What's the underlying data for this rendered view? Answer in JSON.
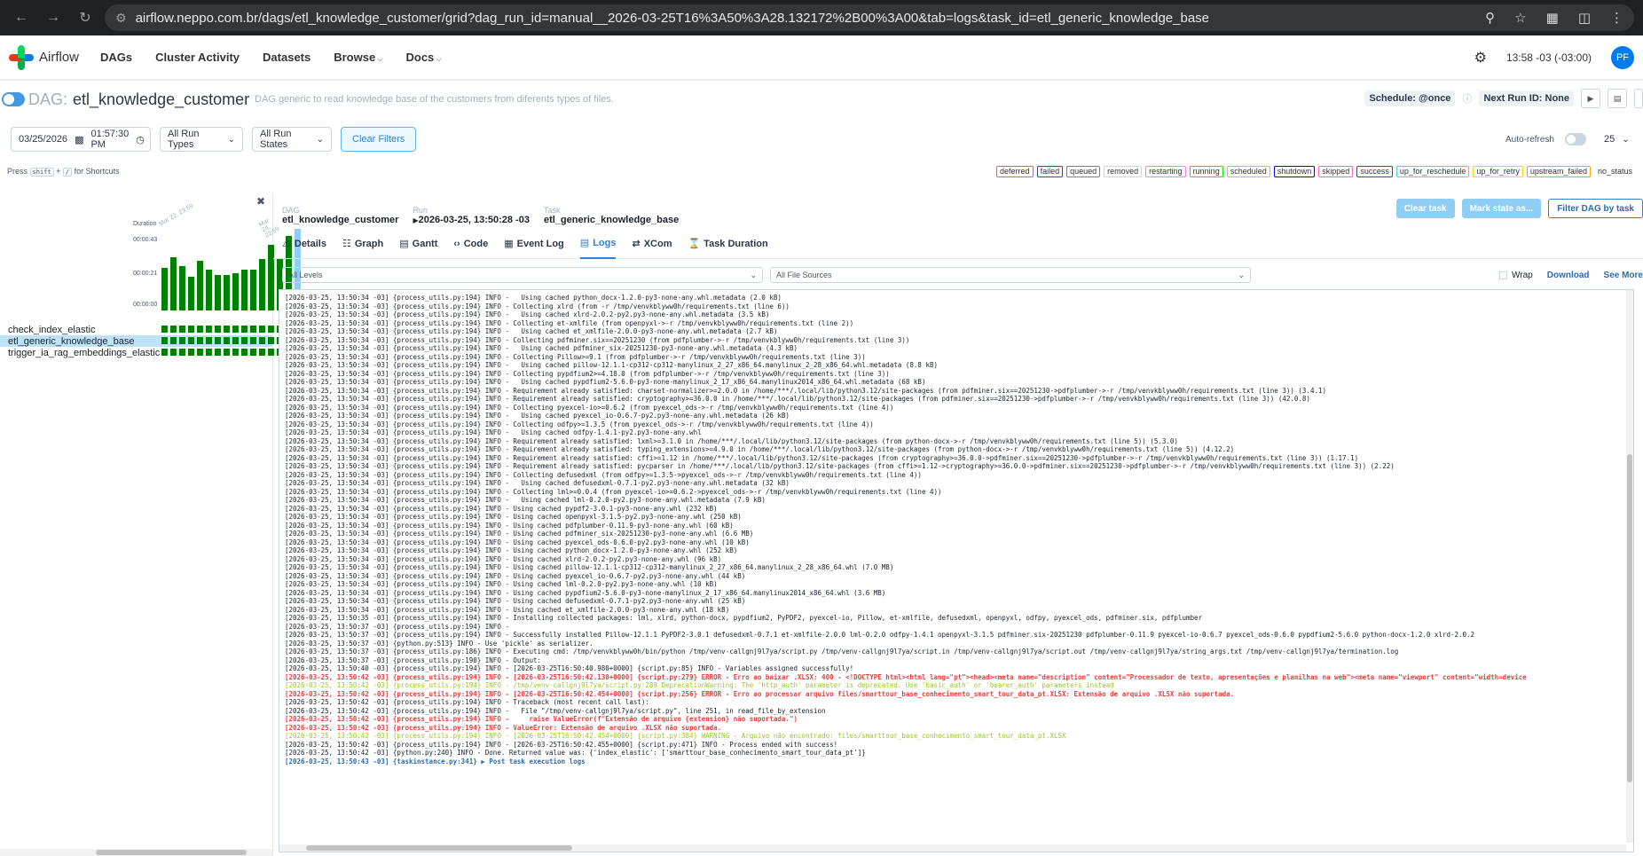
{
  "browser": {
    "url": "airflow.neppo.com.br/dags/etl_knowledge_customer/grid?dag_run_id=manual__2026-03-25T16%3A50%3A28.132172%2B00%3A00&tab=logs&task_id=etl_generic_knowledge_base"
  },
  "nav": {
    "brand": "Airflow",
    "items": [
      "DAGs",
      "Cluster Activity",
      "Datasets",
      "Browse",
      "Docs"
    ],
    "time": "13:58 -03 (-03:00)",
    "avatar": "PF"
  },
  "dag": {
    "prefix": "DAG:",
    "name": "etl_knowledge_customer",
    "description": "DAG generic to read knowledge base of the customers from diferents types of files.",
    "schedule": "Schedule: @once",
    "next_run": "Next Run ID: None"
  },
  "filters": {
    "date": "03/25/2026",
    "time": "01:57:30 PM",
    "run_types": "All Run Types",
    "run_states": "All Run States",
    "clear": "Clear Filters",
    "auto_refresh": "Auto-refresh",
    "page_size": "25"
  },
  "shortcut": {
    "press": "Press",
    "k1": "shift",
    "plus": "+",
    "k2": "/",
    "suffix": "for Shortcuts"
  },
  "legend": [
    {
      "label": "deferred",
      "color": "#9370db"
    },
    {
      "label": "failed",
      "color": "#ff0000"
    },
    {
      "label": "queued",
      "color": "#808080"
    },
    {
      "label": "removed",
      "color": "#d3d3d3"
    },
    {
      "label": "restarting",
      "color": "#ee82ee"
    },
    {
      "label": "running",
      "color": "#00ff00"
    },
    {
      "label": "scheduled",
      "color": "#d2b48c"
    },
    {
      "label": "shutdown",
      "color": "#0000ff"
    },
    {
      "label": "skipped",
      "color": "#ff69b4"
    },
    {
      "label": "success",
      "color": "#008000"
    },
    {
      "label": "up_for_reschedule",
      "color": "#40e0d0"
    },
    {
      "label": "up_for_retry",
      "color": "#ffd700"
    },
    {
      "label": "upstream_failed",
      "color": "#ffa500"
    },
    {
      "label": "no_status",
      "color": "#ffffff"
    }
  ],
  "grid": {
    "duration_label": "Duration",
    "ticks": [
      "00:00:43",
      "00:00:21",
      "00:00:00"
    ],
    "dates": [
      "Mar 22, 23:59",
      "Mar 24, 22:59"
    ],
    "tasks": [
      "check_index_elastic",
      "etl_generic_knowledge_base",
      "trigger_ia_rag_embeddings_elastic"
    ]
  },
  "task_detail": {
    "dag_label": "DAG",
    "dag_value": "etl_knowledge_customer",
    "run_label": "Run",
    "run_value": "2026-03-25, 13:50:28 -03",
    "task_label": "Task",
    "task_value": "etl_generic_knowledge_base",
    "clear_task": "Clear task",
    "mark_state": "Mark state as...",
    "filter_dag": "Filter DAG by task"
  },
  "tabs": [
    "Details",
    "Graph",
    "Gantt",
    "Code",
    "Event Log",
    "Logs",
    "XCom",
    "Task Duration"
  ],
  "log_controls": {
    "levels": "All Levels",
    "sources": "All File Sources",
    "wrap": "Wrap",
    "download": "Download",
    "see_more": "See More"
  },
  "log_lines": [
    {
      "t": "n",
      "s": "[2026-03-25, 13:50:34 -03] {process_utils.py:194} INFO -   Using cached python_docx-1.2.0-py3-none-any.whl.metadata (2.0 kB)"
    },
    {
      "t": "n",
      "s": "[2026-03-25, 13:50:34 -03] {process_utils.py:194} INFO - Collecting xlrd (from -r /tmp/venvkblyww0h/requirements.txt (line 6))"
    },
    {
      "t": "n",
      "s": "[2026-03-25, 13:50:34 -03] {process_utils.py:194} INFO -   Using cached xlrd-2.0.2-py2.py3-none-any.whl.metadata (3.5 kB)"
    },
    {
      "t": "n",
      "s": "[2026-03-25, 13:50:34 -03] {process_utils.py:194} INFO - Collecting et-xmlfile (from openpyxl->-r /tmp/venvkblyww0h/requirements.txt (line 2))"
    },
    {
      "t": "n",
      "s": "[2026-03-25, 13:50:34 -03] {process_utils.py:194} INFO -   Using cached et_xmlfile-2.0.0-py3-none-any.whl.metadata (2.7 kB)"
    },
    {
      "t": "n",
      "s": "[2026-03-25, 13:50:34 -03] {process_utils.py:194} INFO - Collecting pdfminer.six==20251230 (from pdfplumber->-r /tmp/venvkblyww0h/requirements.txt (line 3))"
    },
    {
      "t": "n",
      "s": "[2026-03-25, 13:50:34 -03] {process_utils.py:194} INFO -   Using cached pdfminer_six-20251230-py3-none-any.whl.metadata (4.3 kB)"
    },
    {
      "t": "n",
      "s": "[2026-03-25, 13:50:34 -03] {process_utils.py:194} INFO - Collecting Pillow>=9.1 (from pdfplumber->-r /tmp/venvkblyww0h/requirements.txt (line 3))"
    },
    {
      "t": "n",
      "s": "[2026-03-25, 13:50:34 -03] {process_utils.py:194} INFO -   Using cached pillow-12.1.1-cp312-cp312-manylinux_2_27_x86_64.manylinux_2_28_x86_64.whl.metadata (8.8 kB)"
    },
    {
      "t": "n",
      "s": "[2026-03-25, 13:50:34 -03] {process_utils.py:194} INFO - Collecting pypdfium2>=4.18.0 (from pdfplumber->-r /tmp/venvkblyww0h/requirements.txt (line 3))"
    },
    {
      "t": "n",
      "s": "[2026-03-25, 13:50:34 -03] {process_utils.py:194} INFO -   Using cached pypdfium2-5.6.0-py3-none-manylinux_2_17_x86_64.manylinux2014_x86_64.whl.metadata (68 kB)"
    },
    {
      "t": "n",
      "s": "[2026-03-25, 13:50:34 -03] {process_utils.py:194} INFO - Requirement already satisfied: charset-normalizer>=2.0.0 in /home/***/.local/lib/python3.12/site-packages (from pdfminer.six==20251230->pdfplumber->-r /tmp/venvkblyww0h/requirements.txt (line 3)) (3.4.1)"
    },
    {
      "t": "n",
      "s": "[2026-03-25, 13:50:34 -03] {process_utils.py:194} INFO - Requirement already satisfied: cryptography>=36.0.0 in /home/***/.local/lib/python3.12/site-packages (from pdfminer.six==20251230->pdfplumber->-r /tmp/venvkblyww0h/requirements.txt (line 3)) (42.0.8)"
    },
    {
      "t": "n",
      "s": "[2026-03-25, 13:50:34 -03] {process_utils.py:194} INFO - Collecting pyexcel-io>=0.6.2 (from pyexcel_ods->-r /tmp/venvkblyww0h/requirements.txt (line 4))"
    },
    {
      "t": "n",
      "s": "[2026-03-25, 13:50:34 -03] {process_utils.py:194} INFO -   Using cached pyexcel_io-0.6.7-py2.py3-none-any.whl.metadata (26 kB)"
    },
    {
      "t": "n",
      "s": "[2026-03-25, 13:50:34 -03] {process_utils.py:194} INFO - Collecting odfpy>=1.3.5 (from pyexcel_ods->-r /tmp/venvkblyww0h/requirements.txt (line 4))"
    },
    {
      "t": "n",
      "s": "[2026-03-25, 13:50:34 -03] {process_utils.py:194} INFO -   Using cached odfpy-1.4.1-py2.py3-none-any.whl"
    },
    {
      "t": "n",
      "s": "[2026-03-25, 13:50:34 -03] {process_utils.py:194} INFO - Requirement already satisfied: lxml>=3.1.0 in /home/***/.local/lib/python3.12/site-packages (from python-docx->-r /tmp/venvkblyww0h/requirements.txt (line 5)) (5.3.0)"
    },
    {
      "t": "n",
      "s": "[2026-03-25, 13:50:34 -03] {process_utils.py:194} INFO - Requirement already satisfied: typing_extensions>=4.9.0 in /home/***/.local/lib/python3.12/site-packages (from python-docx->-r /tmp/venvkblyww0h/requirements.txt (line 5)) (4.12.2)"
    },
    {
      "t": "n",
      "s": "[2026-03-25, 13:50:34 -03] {process_utils.py:194} INFO - Requirement already satisfied: cffi>=1.12 in /home/***/.local/lib/python3.12/site-packages (from cryptography>=36.0.0->pdfminer.six==20251230->pdfplumber->-r /tmp/venvkblyww0h/requirements.txt (line 3)) (1.17.1)"
    },
    {
      "t": "n",
      "s": "[2026-03-25, 13:50:34 -03] {process_utils.py:194} INFO - Requirement already satisfied: pycparser in /home/***/.local/lib/python3.12/site-packages (from cffi>=1.12->cryptography>=36.0.0->pdfminer.six==20251230->pdfplumber->-r /tmp/venvkblyww0h/requirements.txt (line 3)) (2.22)"
    },
    {
      "t": "n",
      "s": "[2026-03-25, 13:50:34 -03] {process_utils.py:194} INFO - Collecting defusedxml (from odfpy>=1.3.5->pyexcel_ods->-r /tmp/venvkblyww0h/requirements.txt (line 4))"
    },
    {
      "t": "n",
      "s": "[2026-03-25, 13:50:34 -03] {process_utils.py:194} INFO -   Using cached defusedxml-0.7.1-py2.py3-none-any.whl.metadata (32 kB)"
    },
    {
      "t": "n",
      "s": "[2026-03-25, 13:50:34 -03] {process_utils.py:194} INFO - Collecting lml>=0.0.4 (from pyexcel-io>=0.6.2->pyexcel_ods->-r /tmp/venvkblyww0h/requirements.txt (line 4))"
    },
    {
      "t": "n",
      "s": "[2026-03-25, 13:50:34 -03] {process_utils.py:194} INFO -   Using cached lml-0.2.0-py2.py3-none-any.whl.metadata (7.9 kB)"
    },
    {
      "t": "n",
      "s": "[2026-03-25, 13:50:34 -03] {process_utils.py:194} INFO - Using cached pypdf2-3.0.1-py3-none-any.whl (232 kB)"
    },
    {
      "t": "n",
      "s": "[2026-03-25, 13:50:34 -03] {process_utils.py:194} INFO - Using cached openpyxl-3.1.5-py2.py3-none-any.whl (250 kB)"
    },
    {
      "t": "n",
      "s": "[2026-03-25, 13:50:34 -03] {process_utils.py:194} INFO - Using cached pdfplumber-0.11.9-py3-none-any.whl (60 kB)"
    },
    {
      "t": "n",
      "s": "[2026-03-25, 13:50:34 -03] {process_utils.py:194} INFO - Using cached pdfminer_six-20251230-py3-none-any.whl (6.6 MB)"
    },
    {
      "t": "n",
      "s": "[2026-03-25, 13:50:34 -03] {process_utils.py:194} INFO - Using cached pyexcel_ods-0.6.0-py2.py3-none-any.whl (10 kB)"
    },
    {
      "t": "n",
      "s": "[2026-03-25, 13:50:34 -03] {process_utils.py:194} INFO - Using cached python_docx-1.2.0-py3-none-any.whl (252 kB)"
    },
    {
      "t": "n",
      "s": "[2026-03-25, 13:50:34 -03] {process_utils.py:194} INFO - Using cached xlrd-2.0.2-py2.py3-none-any.whl (96 kB)"
    },
    {
      "t": "n",
      "s": "[2026-03-25, 13:50:34 -03] {process_utils.py:194} INFO - Using cached pillow-12.1.1-cp312-cp312-manylinux_2_27_x86_64.manylinux_2_28_x86_64.whl (7.0 MB)"
    },
    {
      "t": "n",
      "s": "[2026-03-25, 13:50:34 -03] {process_utils.py:194} INFO - Using cached pyexcel_io-0.6.7-py2.py3-none-any.whl (44 kB)"
    },
    {
      "t": "n",
      "s": "[2026-03-25, 13:50:34 -03] {process_utils.py:194} INFO - Using cached lml-0.2.0-py2.py3-none-any.whl (10 kB)"
    },
    {
      "t": "n",
      "s": "[2026-03-25, 13:50:34 -03] {process_utils.py:194} INFO - Using cached pypdfium2-5.6.0-py3-none-manylinux_2_17_x86_64.manylinux2014_x86_64.whl (3.6 MB)"
    },
    {
      "t": "n",
      "s": "[2026-03-25, 13:50:34 -03] {process_utils.py:194} INFO - Using cached defusedxml-0.7.1-py2.py3-none-any.whl (25 kB)"
    },
    {
      "t": "n",
      "s": "[2026-03-25, 13:50:34 -03] {process_utils.py:194} INFO - Using cached et_xmlfile-2.0.0-py3-none-any.whl (18 kB)"
    },
    {
      "t": "n",
      "s": "[2026-03-25, 13:50:35 -03] {process_utils.py:194} INFO - Installing collected packages: lml, xlrd, python-docx, pypdfium2, PyPDF2, pyexcel-io, Pillow, et-xmlfile, defusedxml, openpyxl, odfpy, pyexcel_ods, pdfminer.six, pdfplumber"
    },
    {
      "t": "n",
      "s": "[2026-03-25, 13:50:37 -03] {process_utils.py:194} INFO -"
    },
    {
      "t": "n",
      "s": "[2026-03-25, 13:50:37 -03] {process_utils.py:194} INFO - Successfully installed Pillow-12.1.1 PyPDF2-3.0.1 defusedxml-0.7.1 et-xmlfile-2.0.0 lml-0.2.0 odfpy-1.4.1 openpyxl-3.1.5 pdfminer.six-20251230 pdfplumber-0.11.9 pyexcel-io-0.6.7 pyexcel_ods-0.6.0 pypdfium2-5.6.0 python-docx-1.2.0 xlrd-2.0.2"
    },
    {
      "t": "n",
      "s": "[2026-03-25, 13:50:37 -03] {python.py:513} INFO - Use 'pickle' as serializer."
    },
    {
      "t": "n",
      "s": "[2026-03-25, 13:50:37 -03] {process_utils.py:186} INFO - Executing cmd: /tmp/venvkblyww0h/bin/python /tmp/venv-callgnj9l7ya/script.py /tmp/venv-callgnj9l7ya/script.in /tmp/venv-callgnj9l7ya/script.out /tmp/venv-callgnj9l7ya/string_args.txt /tmp/venv-callgnj9l7ya/termination.log"
    },
    {
      "t": "n",
      "s": "[2026-03-25, 13:50:37 -03] {process_utils.py:190} INFO - Output:"
    },
    {
      "t": "n",
      "s": "[2026-03-25, 13:50:40 -03] {process_utils.py:194} INFO - [2026-03-25T16:50:40.980+0000] {script.py:85} INFO - Variables assigned successfully!"
    },
    {
      "t": "e",
      "s": "[2026-03-25, 13:50:42 -03] {process_utils.py:194} INFO - [2026-03-25T16:50:42.130+0000] {script.py:279} ERROR - Erro ao baixar .XLSX: 400 - <!DOCTYPE html><html lang=\"pt\"><head><meta name=\"description\" content=\"Processador de texto, apresentações e planilhas na web\"><meta name=\"viewport\" content=\"width=device"
    },
    {
      "t": "w",
      "s": "[2026-03-25, 13:50:42 -03] {process_utils.py:194} INFO - /tmp/venv-callgnj9l7ya/script.py:289 DeprecationWarning: The 'http_auth' parameter is deprecated. Use 'basic_auth' or 'bearer_auth' parameters instead"
    },
    {
      "t": "e",
      "s": "[2026-03-25, 13:50:42 -03] {process_utils.py:194} INFO - [2026-03-25T16:50:42.454+0000] {script.py:256} ERROR - Erro ao processar arquivo files/smarttour_base_conhecimento_smart_tour_data_pt.XLSX: Extensão de arquivo .XLSX não suportada."
    },
    {
      "t": "n",
      "s": "[2026-03-25, 13:50:42 -03] {process_utils.py:194} INFO - Traceback (most recent call last):"
    },
    {
      "t": "n",
      "s": "[2026-03-25, 13:50:42 -03] {process_utils.py:194} INFO -   File \"/tmp/venv-callgnj9l7ya/script.py\", line 251, in read_file_by_extension"
    },
    {
      "t": "e",
      "s": "[2026-03-25, 13:50:42 -03] {process_utils.py:194} INFO -     raise ValueError(f\"Extensão de arquivo {extension} não suportada.\")"
    },
    {
      "t": "e",
      "s": "[2026-03-25, 13:50:42 -03] {process_utils.py:194} INFO - ValueError: Extensão de arquivo .XLSX não suportada."
    },
    {
      "t": "w",
      "s": "[2026-03-25, 13:50:42 -03] {process_utils.py:194} INFO - [2026-03-25T16:50:42.454+0000] {script.py:384} WARNING - Arquivo não encontrado: files/smarttour_base_conhecimento_smart_tour_data_pt.XLSX"
    },
    {
      "t": "n",
      "s": "[2026-03-25, 13:50:42 -03] {process_utils.py:194} INFO - [2026-03-25T16:50:42.455+0000] {script.py:471} INFO - Process ended with success!"
    },
    {
      "t": "n",
      "s": "[2026-03-25, 13:50:42 -03] {python.py:240} INFO - Done. Returned value was: {'index_elastic': ['smarttour_base_conhecimento_smart_tour_data_pt']}"
    },
    {
      "t": "l",
      "s": "[2026-03-25, 13:50:43 -03] {taskinstance.py:341} ▶ Post task execution logs"
    }
  ]
}
